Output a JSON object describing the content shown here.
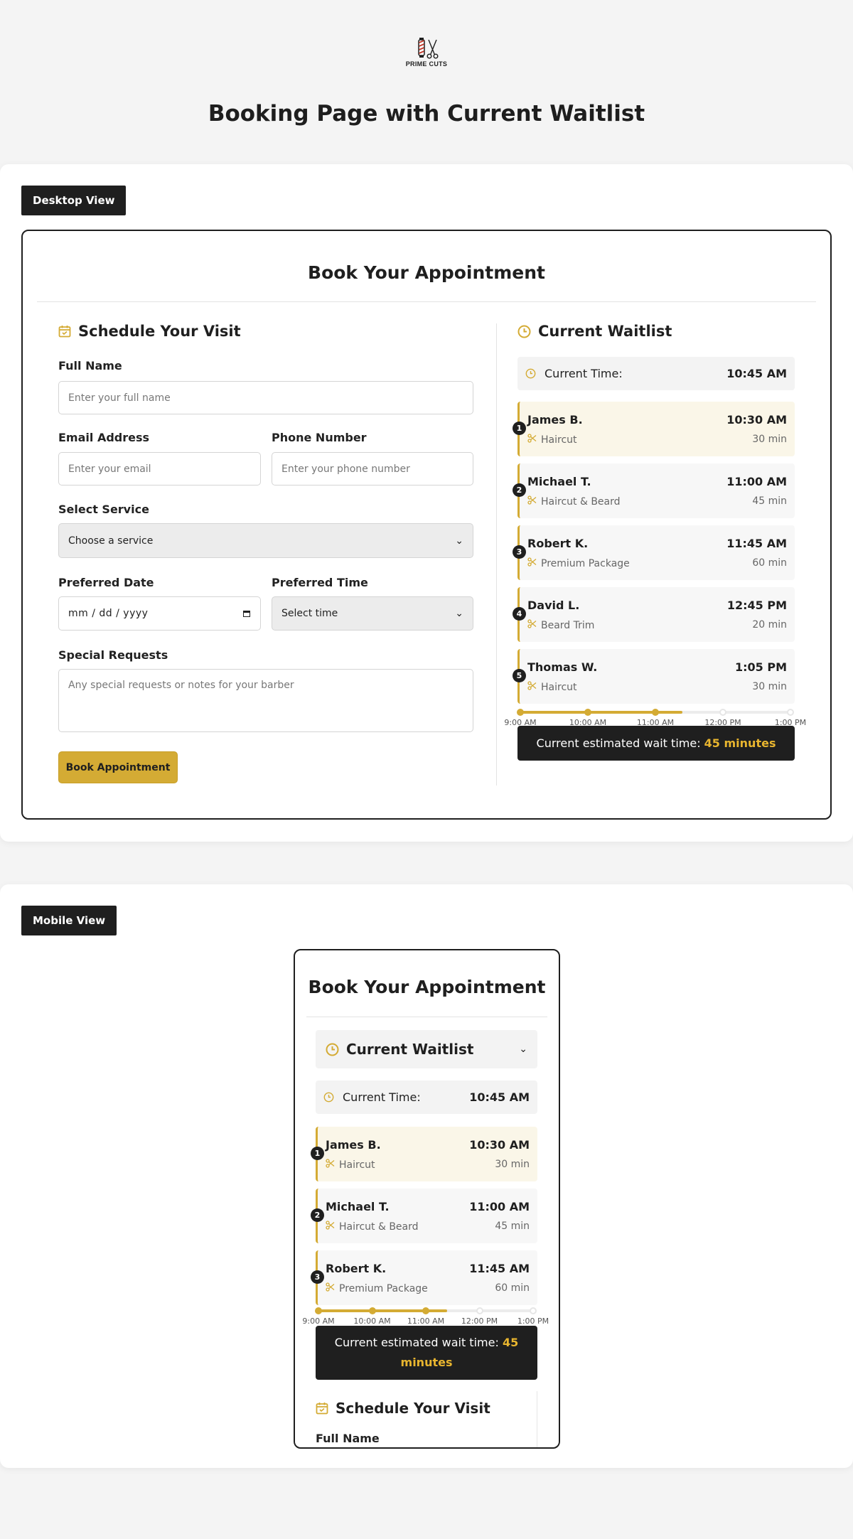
{
  "brand": {
    "logo_text": "PRIME CUTS"
  },
  "page_title": "Booking Page with Current Waitlist",
  "desktop": {
    "view_label": "Desktop View"
  },
  "mobile": {
    "view_label": "Mobile View"
  },
  "booking": {
    "title": "Book Your Appointment",
    "schedule_heading": "Schedule Your Visit",
    "full_name_label": "Full Name",
    "full_name_placeholder": "Enter your full name",
    "email_label": "Email Address",
    "email_placeholder": "Enter your email",
    "phone_label": "Phone Number",
    "phone_placeholder": "Enter your phone number",
    "service_label": "Select Service",
    "service_value": "Choose a service",
    "date_label": "Preferred Date",
    "date_value": "mm / dd / yyyy",
    "time_label": "Preferred Time",
    "time_value": "Select time",
    "requests_label": "Special Requests",
    "requests_placeholder": "Any special requests or notes for your barber",
    "submit_label": "Book Appointment"
  },
  "waitlist": {
    "heading": "Current Waitlist",
    "current_time_label": "Current Time:",
    "current_time": "10:45 AM",
    "entries": [
      {
        "position": "1",
        "name": "James B.",
        "time": "10:30 AM",
        "service": "Haircut",
        "duration": "30 min"
      },
      {
        "position": "2",
        "name": "Michael T.",
        "time": "11:00 AM",
        "service": "Haircut & Beard",
        "duration": "45 min"
      },
      {
        "position": "3",
        "name": "Robert K.",
        "time": "11:45 AM",
        "service": "Premium Package",
        "duration": "60 min"
      },
      {
        "position": "4",
        "name": "David L.",
        "time": "12:45 PM",
        "service": "Beard Trim",
        "duration": "20 min"
      },
      {
        "position": "5",
        "name": "Thomas W.",
        "time": "1:05 PM",
        "service": "Haircut",
        "duration": "30 min"
      }
    ],
    "timeline": {
      "labels": [
        "9:00 AM",
        "10:00 AM",
        "11:00 AM",
        "12:00 PM",
        "1:00 PM"
      ],
      "progress": 0.6
    },
    "wait_text": "Current estimated wait time:",
    "wait_value": "45 minutes"
  },
  "colors": {
    "accent": "#d4ab34",
    "dark": "#1f1f1f",
    "highlight_bg": "#faf6e8"
  },
  "icons": {
    "calendar": "calendar-icon",
    "clock": "clock-icon",
    "scissors": "scissors-icon",
    "chevron": "chevron-down-icon"
  }
}
